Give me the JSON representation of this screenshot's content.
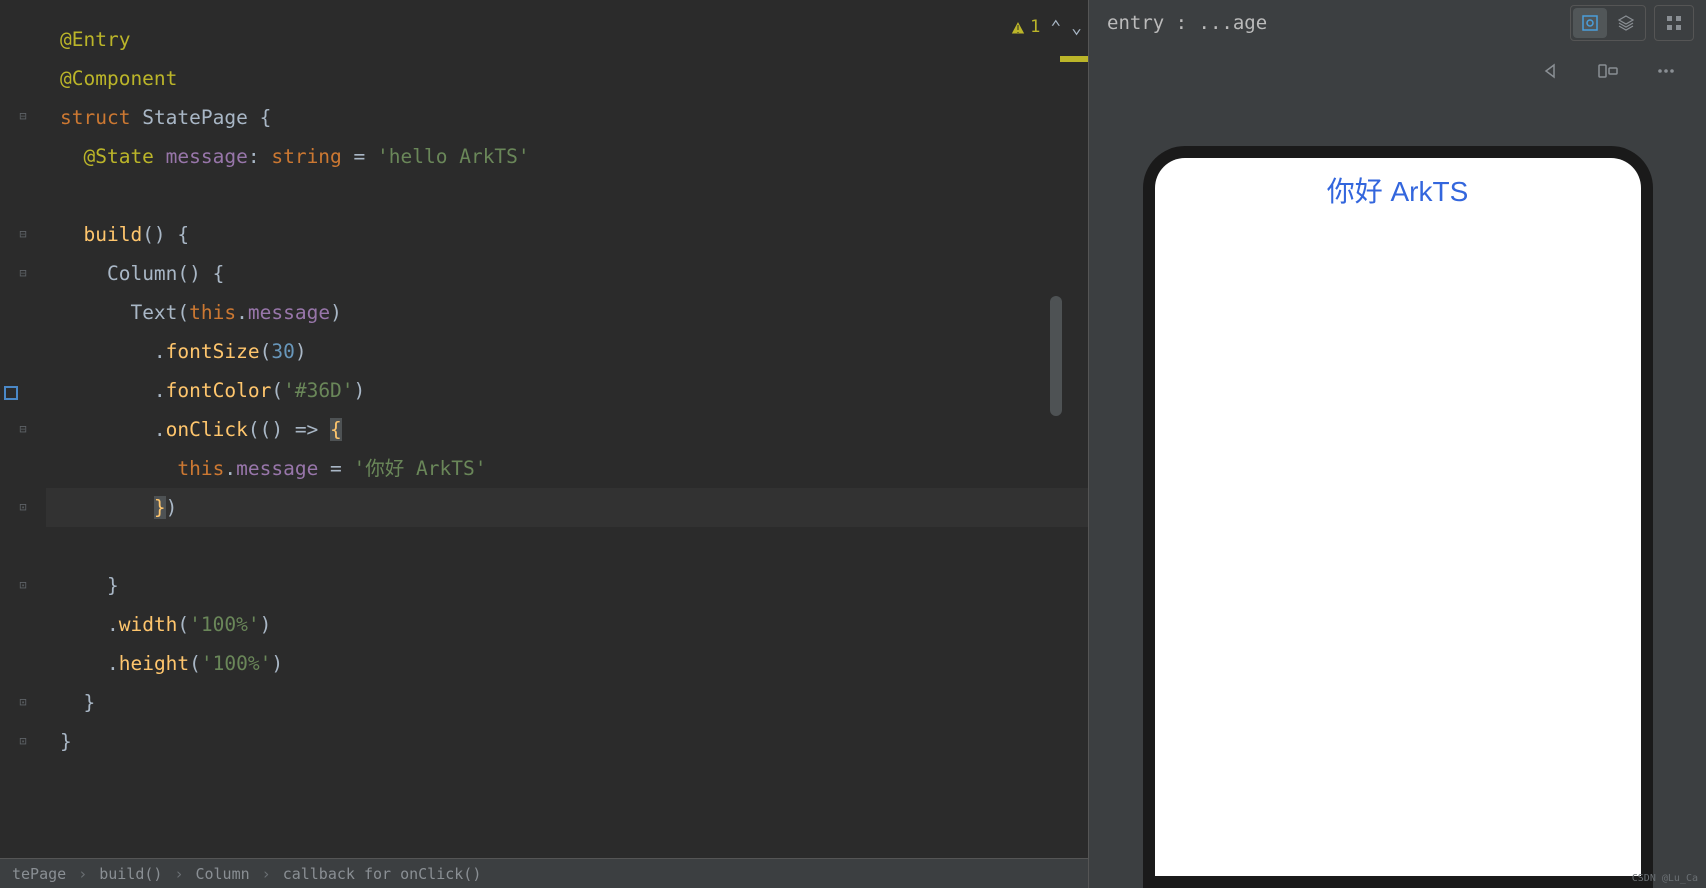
{
  "editor": {
    "warning_count": "1",
    "code": {
      "l1_entry": "@Entry",
      "l2_component": "@Component",
      "l3_struct": "struct",
      "l3_name": "StatePage",
      "l3_brace": " {",
      "l4_state": "@State",
      "l4_prop": " message",
      "l4_colon": ":",
      "l4_type": " string",
      "l4_eq": " = ",
      "l4_str": "'hello ArkTS'",
      "l6_build": "build",
      "l6_rest": "() {",
      "l7_column": "Column",
      "l7_rest": "() {",
      "l8_text": "Text",
      "l8_open": "(",
      "l8_this": "this",
      "l8_dot": ".",
      "l8_msg": "message",
      "l8_close": ")",
      "l9_dot": ".",
      "l9_fontsize": "fontSize",
      "l9_open": "(",
      "l9_num": "30",
      "l9_close": ")",
      "l10_dot": ".",
      "l10_fontcolor": "fontColor",
      "l10_open": "(",
      "l10_str": "'#36D'",
      "l10_close": ")",
      "l11_dot": ".",
      "l11_onclick": "onClick",
      "l11_open": "(() => ",
      "l11_brace": "{",
      "l12_this": "this",
      "l12_dot": ".",
      "l12_msg": "message",
      "l12_eq": " = ",
      "l12_str": "'你好 ArkTS'",
      "l13_brace": "}",
      "l13_close": ")",
      "l15_close": "}",
      "l16_dot": ".",
      "l16_width": "width",
      "l16_open": "(",
      "l16_str": "'100%'",
      "l16_close": ")",
      "l17_dot": ".",
      "l17_height": "height",
      "l17_open": "(",
      "l17_str": "'100%'",
      "l17_close": ")",
      "l18_close": "}",
      "l19_close": "}"
    },
    "breadcrumb": {
      "item1": "tePage",
      "item2": "build()",
      "item3": "Column",
      "item4": "callback for onClick()"
    }
  },
  "preview": {
    "title": "entry : ...age",
    "device_text": "你好 ArkTS"
  },
  "watermark": "CSDN @Lu_Ca"
}
